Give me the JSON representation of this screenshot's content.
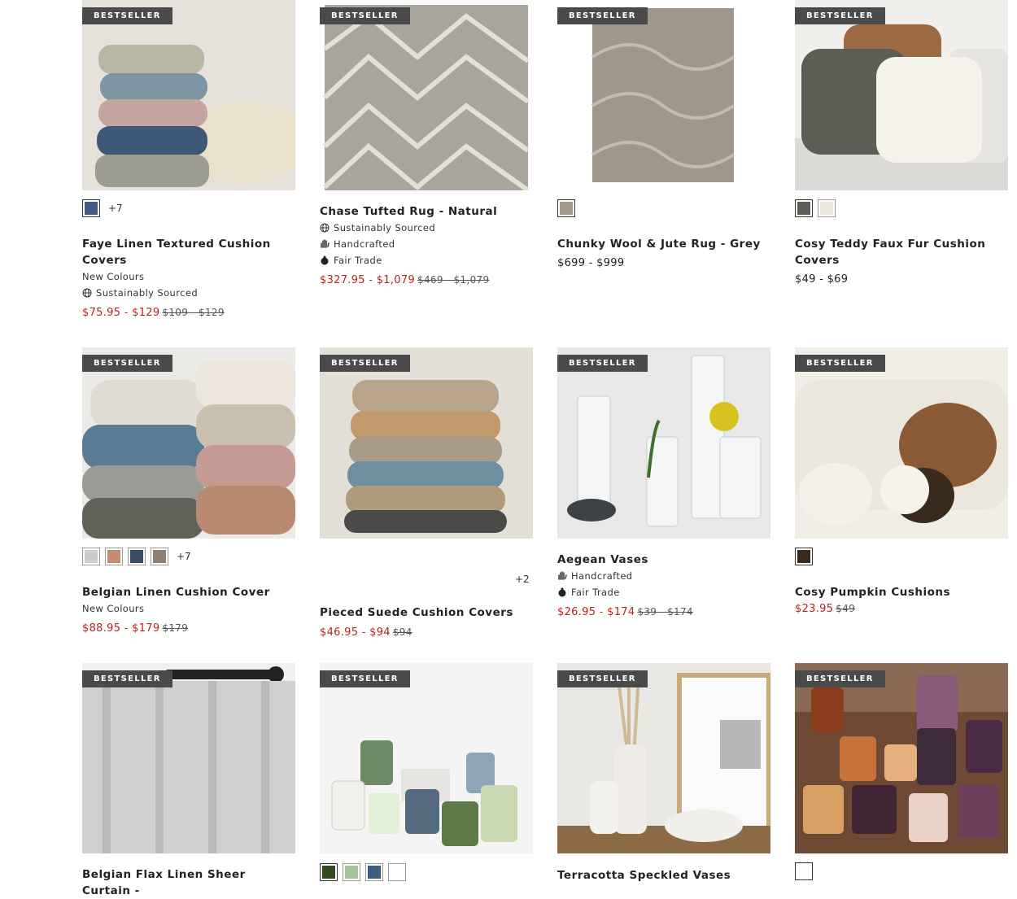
{
  "badge_label": "BESTSELLER",
  "products": [
    {
      "title": "Faye Linen Textured Cushion Covers",
      "more": "+7",
      "new_label": "New Colours",
      "tags": [
        "Sustainably Sourced"
      ],
      "price_sale": "$75.95 - $129",
      "price_orig": "$109 - $129"
    },
    {
      "title": "Chase Tufted Rug - Natural",
      "tags": [
        "Sustainably Sourced",
        "Handcrafted",
        "Fair Trade"
      ],
      "price_sale": "$327.95 - $1,079",
      "price_orig": "$469 - $1,079"
    },
    {
      "title": "Chunky Wool & Jute Rug - Grey",
      "price": "$699 - $999"
    },
    {
      "title": "Cosy Teddy Faux Fur Cushion Covers",
      "price": "$49 - $69"
    },
    {
      "title": "Belgian Linen Cushion Cover",
      "more": "+7",
      "new_label": "New Colours",
      "price_sale": "$88.95 - $179",
      "price_orig": "$179"
    },
    {
      "title": "Pieced Suede Cushion Covers",
      "more": "+2",
      "price_sale": "$46.95 - $94",
      "price_orig": "$94"
    },
    {
      "title": "Aegean Vases",
      "tags": [
        "Handcrafted",
        "Fair Trade"
      ],
      "price_sale": "$26.95 - $174",
      "price_orig": "$39 - $174"
    },
    {
      "title": "Cosy Pumpkin Cushions",
      "price_sale": "$23.95",
      "price_orig": "$49"
    },
    {
      "title": "Belgian Flax Linen Sheer Curtain -"
    },
    {
      "title": ""
    },
    {
      "title": "Terracotta Speckled Vases"
    },
    {
      "title": ""
    }
  ],
  "swatch_colors": {
    "p0": [
      "#3f5b8c"
    ],
    "p2": [
      "#a59a8e"
    ],
    "p3": [
      "#5a5e55",
      "#ece7db"
    ],
    "p4": [
      "#c9cdcf",
      "#c48c72",
      "#3c4a62",
      "#8c7f75"
    ],
    "p7": [
      "#3a2a1c"
    ],
    "p9": [
      "#2f4a1e",
      "#a9c29a",
      "#3e5d80",
      "#ffffff"
    ],
    "p11": [
      "#ffffff"
    ]
  },
  "icons": {
    "sustainable": "globe-icon",
    "handcrafted": "hand-icon",
    "fair_trade": "fair-trade-icon"
  }
}
